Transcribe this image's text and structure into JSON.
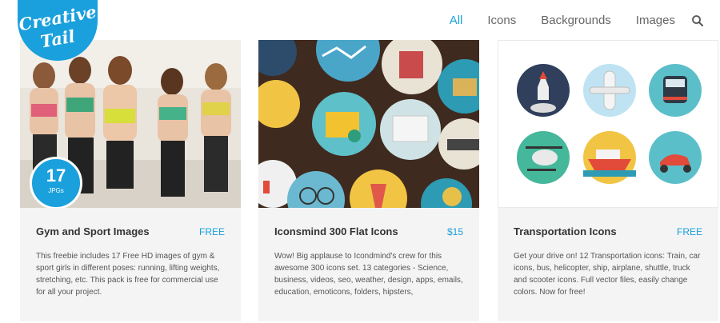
{
  "brand": {
    "line1": "Creative",
    "line2": "Tail"
  },
  "nav": {
    "items": [
      "All",
      "Icons",
      "Backgrounds",
      "Images"
    ],
    "active": "All"
  },
  "cards": [
    {
      "title": "Gym and Sport Images",
      "price": "FREE",
      "badge": {
        "number": "17",
        "unit": "JPGs"
      },
      "description": "This freebie includes 17 Free HD images of gym & sport girls in different poses: running, lifting weights, stretching, etc. This pack is free for commercial use for all your project."
    },
    {
      "title": "Iconsmind 300 Flat Icons",
      "price": "$15",
      "description": "Wow! Big applause to Icondmind's crew for this awesome 300 icons set. 13 categories - Science, business, videos, seo, weather, design, apps, emails, education, emoticons, folders, hipsters,"
    },
    {
      "title": "Transportation Icons",
      "price": "FREE",
      "description": "Get your drive on! 12 Transportation icons: Train, car icons, bus, helicopter, ship, airplane, shuttle, truck and scooter icons. Full vector files, easily change colors. Now for free!"
    }
  ],
  "colors": {
    "accent": "#1aa0dc",
    "card_bg": "#f4f4f4"
  }
}
